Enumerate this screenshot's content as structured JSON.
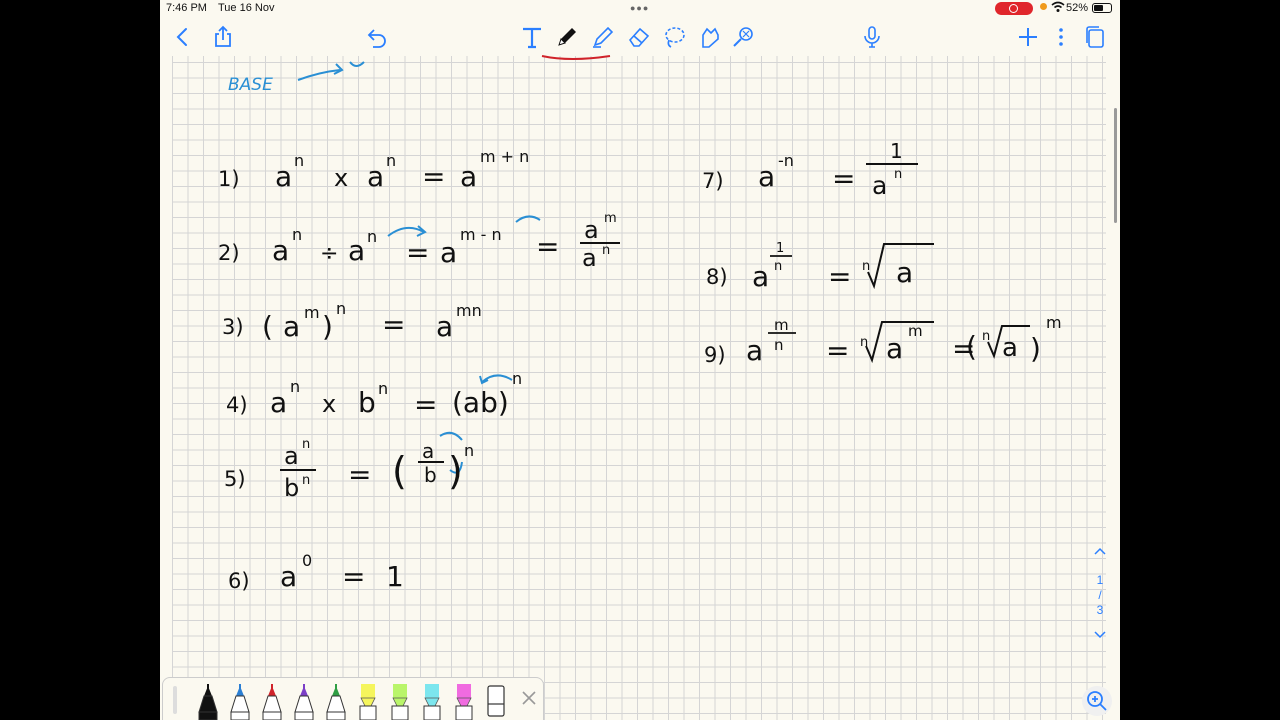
{
  "status": {
    "time": "7:46 PM",
    "date": "Tue 16 Nov",
    "battery": "52%"
  },
  "toolbar": {
    "icons": [
      "chevron-left-icon",
      "share-icon",
      "undo-icon",
      "text-tool-icon",
      "pen-icon",
      "highlighter-icon",
      "eraser-icon",
      "lasso-icon",
      "sticker-icon",
      "laser-icon",
      "microphone-icon",
      "plus-icon",
      "more-icon",
      "pages-icon"
    ]
  },
  "notes": {
    "header_fragment": "BASE",
    "r1": {
      "num": "1)",
      "lhs1": "a",
      "e1": "n",
      "op": "x",
      "lhs2": "a",
      "e2": "n",
      "eq": "=",
      "rhs": "a",
      "er": "m + n"
    },
    "r2": {
      "num": "2)",
      "lhs1": "a",
      "e1": "n",
      "op": "÷",
      "lhs2": "a",
      "e2": "n",
      "eq": "=",
      "rhs": "a",
      "er": "m - n",
      "eq2": "=",
      "fn": "a",
      "fne": "m",
      "fd": "a",
      "fde": "n"
    },
    "r3": {
      "num": "3)",
      "open": "(",
      "base": "a",
      "e1": "m",
      "close": ")",
      "e2": "n",
      "eq": "=",
      "rhs": "a",
      "er": "mn"
    },
    "r4": {
      "num": "4)",
      "a": "a",
      "ea": "n",
      "op": "x",
      "b": "b",
      "eb": "n",
      "eq": "=",
      "rhs": "(ab)",
      "er": "n"
    },
    "r5": {
      "num": "5)",
      "fn": "a",
      "fne": "n",
      "fd": "b",
      "fde": "n",
      "eq": "=",
      "open": "(",
      "in_n": "a",
      "in_d": "b",
      "close": ")",
      "er": "n"
    },
    "r6": {
      "num": "6)",
      "base": "a",
      "e": "0",
      "eq": "=",
      "rhs": "1"
    },
    "r7": {
      "num": "7)",
      "base": "a",
      "e": "-n",
      "eq": "=",
      "fn": "1",
      "fd": "a",
      "fde": "n"
    },
    "r8": {
      "num": "8)",
      "base": "a",
      "en": "1",
      "ed": "n",
      "eq": "=",
      "idx": "n",
      "rad": "a"
    },
    "r9": {
      "num": "9)",
      "base": "a",
      "en": "m",
      "ed": "n",
      "eq": "=",
      "idx": "n",
      "rad": "a",
      "rade": "m",
      "eq2": "=",
      "open": "(",
      "idx2": "n",
      "rad2": "a",
      "close": ")",
      "er": "m"
    }
  },
  "pager": {
    "current": "1",
    "sep": "/",
    "total": "3"
  },
  "penbar": {
    "pens": [
      {
        "name": "black-pen",
        "color": "#111111"
      },
      {
        "name": "blue-pen",
        "color": "#2a7fd4"
      },
      {
        "name": "red-pen",
        "color": "#d0232a"
      },
      {
        "name": "purple-pen",
        "color": "#7b3fc7"
      },
      {
        "name": "green-pen",
        "color": "#2f9e44"
      },
      {
        "name": "yellow-highlighter",
        "color": "#f5f55c"
      },
      {
        "name": "lime-highlighter",
        "color": "#b9f56a"
      },
      {
        "name": "cyan-highlighter",
        "color": "#7ce6ee"
      },
      {
        "name": "pink-highlighter",
        "color": "#f06be0"
      },
      {
        "name": "eraser",
        "color": "#ffffff"
      }
    ],
    "close_icon": "close-icon"
  },
  "colors": {
    "accent": "#2b7fff",
    "ink": "#111111",
    "blue_ink": "#2a8fd4",
    "red_ink": "#d0232a",
    "record": "#e0262b"
  }
}
